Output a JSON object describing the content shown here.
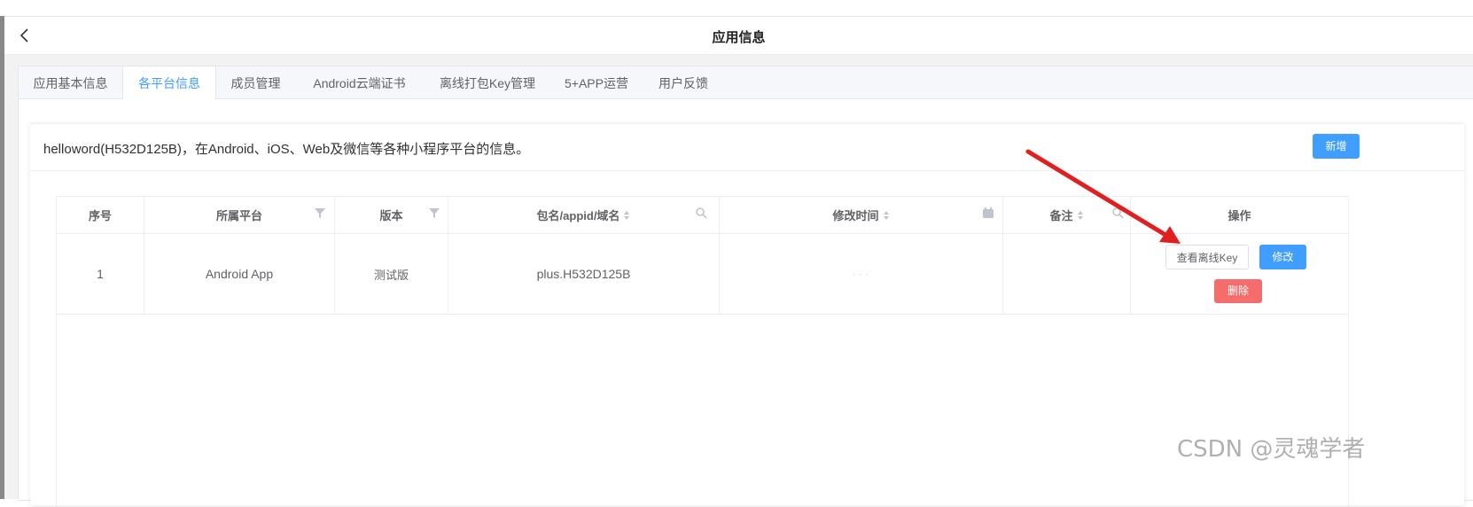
{
  "header": {
    "title": "应用信息"
  },
  "tabs": [
    {
      "label": "应用基本信息"
    },
    {
      "label": "各平台信息"
    },
    {
      "label": "成员管理"
    },
    {
      "label": "Android云端证书"
    },
    {
      "label": "离线打包Key管理"
    },
    {
      "label": "5+APP运营"
    },
    {
      "label": "用户反馈"
    }
  ],
  "active_tab": "各平台信息",
  "card": {
    "description": "helloword(H532D125B)，在Android、iOS、Web及微信等各种小程序平台的信息。",
    "add_button": "新增"
  },
  "table": {
    "columns": [
      "序号",
      "所属平台",
      "版本",
      "包名/appid/域名",
      "修改时间",
      "备注",
      "操作"
    ],
    "rows": [
      {
        "index": "1",
        "platform": "Android App",
        "version": "测试版",
        "package": "plus.H532D125B",
        "modified": "· · ·",
        "remark": "",
        "actions": {
          "view_key": "查看离线Key",
          "edit": "修改",
          "delete": "删除"
        }
      }
    ]
  },
  "watermark": "CSDN @灵魂学者",
  "colors": {
    "primary": "#409eff",
    "danger": "#f56c6c",
    "arrow": "#e02020"
  }
}
